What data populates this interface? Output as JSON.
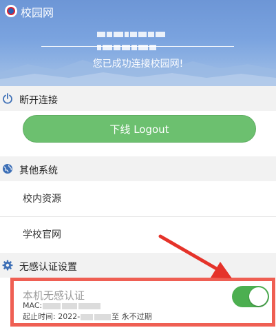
{
  "header": {
    "app_title": "校园网",
    "status_text": "您已成功连接校园网!"
  },
  "disconnect_section": {
    "title": "断开连接",
    "logout_label": "下线 Logout"
  },
  "other_systems_section": {
    "title": "其他系统",
    "items": [
      {
        "label": "校内资源"
      },
      {
        "label": "学校官网"
      }
    ]
  },
  "seamless_auth_section": {
    "title": "无感认证设置",
    "card": {
      "title": "本机无感认证",
      "mac_prefix": "MAC:",
      "start_prefix": "起止时间: 2022-",
      "start_suffix": "至 永不过期",
      "toggle_on": true
    }
  },
  "colors": {
    "header_blue": "#7aa3df",
    "logout_green": "#6cc06f",
    "toggle_green": "#4caf50",
    "highlight_red": "#ef5f53",
    "icon_blue": "#3d6fb6"
  }
}
